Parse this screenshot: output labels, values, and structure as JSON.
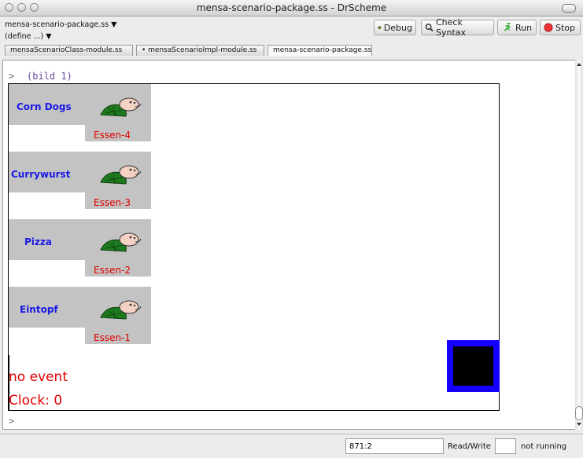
{
  "window": {
    "title": "mensa-scenario-package.ss - DrScheme"
  },
  "toolbar": {
    "file_menu": "mensa-scenario-package.ss ▼",
    "define_menu": "(define ...) ▼",
    "debug_label": "Debug",
    "check_syntax_label": "Check Syntax",
    "run_label": "Run",
    "stop_label": "Stop"
  },
  "tabs": [
    {
      "label": "mensaScenarioClass-module.ss"
    },
    {
      "label": "• mensaScenarioImpl-module.ss"
    },
    {
      "label": "mensa-scenario-package.ss"
    }
  ],
  "repl": {
    "prompt": ">",
    "command": "(bild 1)",
    "prompt2": ">"
  },
  "scene": {
    "items": [
      {
        "food": "Corn Dogs",
        "label": "Essen-4"
      },
      {
        "food": "Currywurst",
        "label": "Essen-3"
      },
      {
        "food": "Pizza",
        "label": "Essen-2"
      },
      {
        "food": "Eintopf",
        "label": "Essen-1"
      }
    ],
    "event_text": "no event",
    "clock_text": "Clock: 0"
  },
  "status": {
    "position": "871:2",
    "mode": "Read/Write",
    "state": "not running"
  },
  "colors": {
    "food_text": "#1a1ae6",
    "essen_text": "#e10000",
    "box_outer": "#1500ff",
    "box_inner": "#000000"
  }
}
